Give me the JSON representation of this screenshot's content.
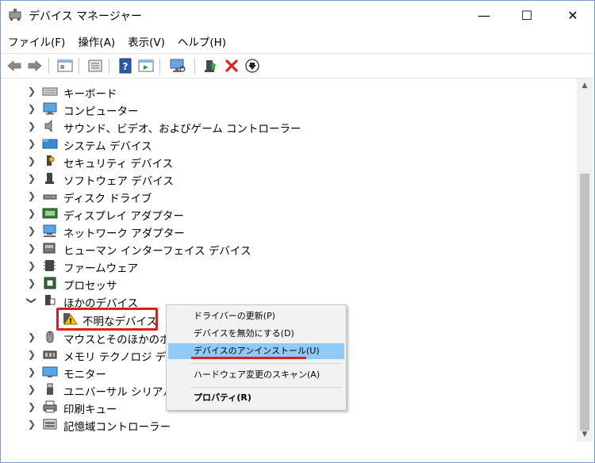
{
  "window": {
    "title": "デバイス マネージャー",
    "controls": {
      "minimize": "—",
      "maximize": "☐",
      "close": "✕"
    }
  },
  "menubar": [
    {
      "label": "ファイル(F)"
    },
    {
      "label": "操作(A)"
    },
    {
      "label": "表示(V)"
    },
    {
      "label": "ヘルプ(H)"
    }
  ],
  "toolbar": {
    "icons": [
      "back-arrow-icon",
      "forward-arrow-icon",
      "properties-icon",
      "show-hide-icon",
      "help-icon",
      "action-icon",
      "monitor-scan-icon",
      "update-driver-icon",
      "uninstall-x-icon",
      "download-icon"
    ]
  },
  "tree": {
    "items": [
      {
        "label": "キーボード",
        "icon": "keyboard-icon",
        "expanded": false
      },
      {
        "label": "コンピューター",
        "icon": "computer-icon",
        "expanded": false
      },
      {
        "label": "サウンド、ビデオ、およびゲーム コントローラー",
        "icon": "speaker-icon",
        "expanded": false
      },
      {
        "label": "システム デバイス",
        "icon": "system-folder-icon",
        "expanded": false
      },
      {
        "label": "セキュリティ デバイス",
        "icon": "security-key-icon",
        "expanded": false
      },
      {
        "label": "ソフトウェア デバイス",
        "icon": "software-device-icon",
        "expanded": false
      },
      {
        "label": "ディスク ドライブ",
        "icon": "disk-drive-icon",
        "expanded": false
      },
      {
        "label": "ディスプレイ アダプター",
        "icon": "display-adapter-icon",
        "expanded": false
      },
      {
        "label": "ネットワーク アダプター",
        "icon": "network-adapter-icon",
        "expanded": false
      },
      {
        "label": "ヒューマン インターフェイス デバイス",
        "icon": "hid-icon",
        "expanded": false
      },
      {
        "label": "ファームウェア",
        "icon": "firmware-icon",
        "expanded": false
      },
      {
        "label": "プロセッサ",
        "icon": "processor-icon",
        "expanded": false
      },
      {
        "label": "ほかのデバイス",
        "icon": "other-devices-icon",
        "expanded": true
      },
      {
        "label": "不明なデバイス",
        "icon": "unknown-device-warning-icon",
        "child": true
      },
      {
        "label": "マウスとそのほかのポイ",
        "icon": "mouse-icon",
        "expanded": false
      },
      {
        "label": "メモリ テクノロジ デバイ",
        "icon": "memory-icon",
        "expanded": false
      },
      {
        "label": "モニター",
        "icon": "monitor-icon",
        "expanded": false
      },
      {
        "label": "ユニバーサル シリアル /",
        "icon": "usb-icon",
        "expanded": false
      },
      {
        "label": "印刷キュー",
        "icon": "printer-icon",
        "expanded": false
      },
      {
        "label": "記憶域コントローラー",
        "icon": "storage-controller-icon",
        "expanded": false
      }
    ]
  },
  "context_menu": {
    "items": [
      {
        "label": "ドライバーの更新(P)"
      },
      {
        "label": "デバイスを無効にする(D)"
      },
      {
        "label": "デバイスのアンインストール(U)",
        "selected": true
      },
      {
        "label": "ハードウェア変更のスキャン(A)"
      },
      {
        "label": "プロパティ(R)",
        "bold": true
      }
    ]
  },
  "colors": {
    "accent_highlight": "#e01c1c",
    "selection": "#91c9f7",
    "menu_background": "#f2f2f2"
  }
}
